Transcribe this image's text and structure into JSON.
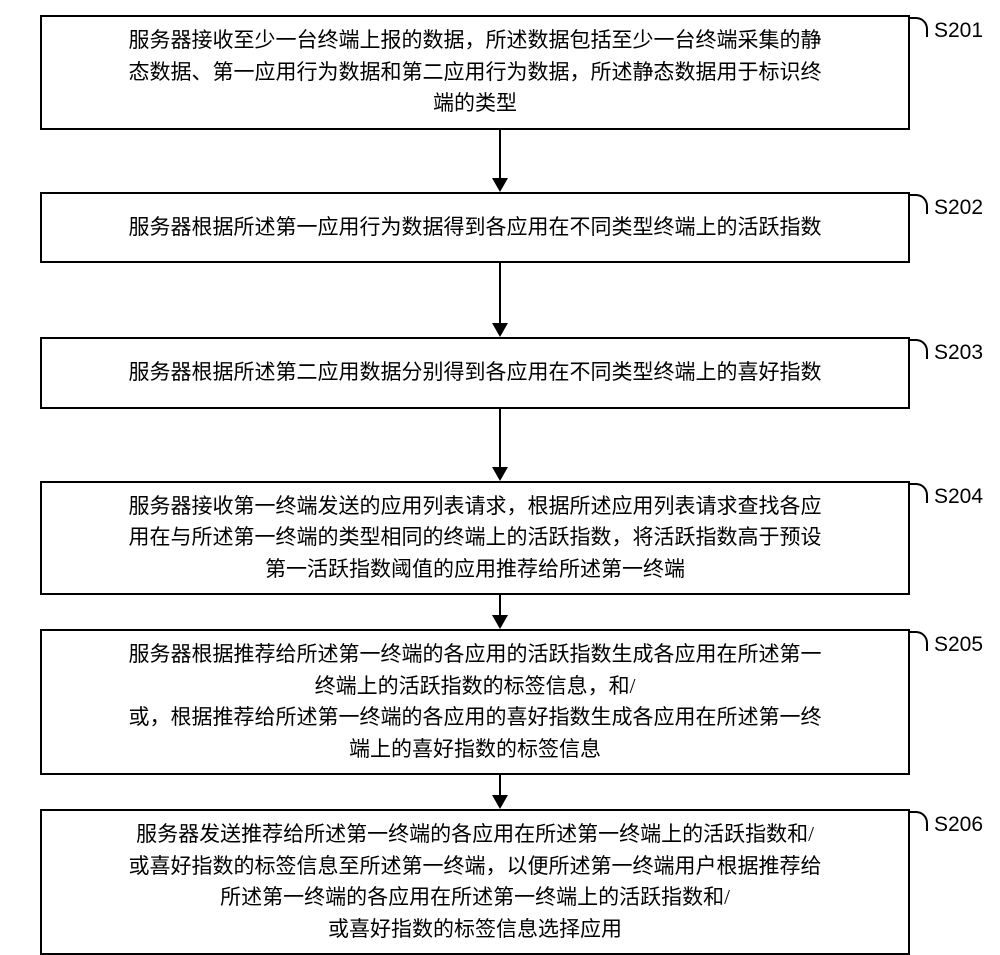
{
  "flowchart": {
    "steps": [
      {
        "id": "S201",
        "lines": [
          "服务器接收至少一台终端上报的数据，所述数据包括至少一台终端采集的静",
          "态数据、第一应用行为数据和第二应用行为数据，所述静态数据用于标识终",
          "端的类型"
        ],
        "arrowHeight": 48
      },
      {
        "id": "S202",
        "lines": [
          "服务器根据所述第一应用行为数据得到各应用在不同类型终端上的活跃指数"
        ],
        "arrowHeight": 60
      },
      {
        "id": "S203",
        "lines": [
          "服务器根据所述第二应用数据分别得到各应用在不同类型终端上的喜好指数"
        ],
        "arrowHeight": 58
      },
      {
        "id": "S204",
        "lines": [
          "服务器接收第一终端发送的应用列表请求，根据所述应用列表请求查找各应",
          "用在与所述第一终端的类型相同的终端上的活跃指数，将活跃指数高于预设",
          "第一活跃指数阈值的应用推荐给所述第一终端"
        ],
        "arrowHeight": 20
      },
      {
        "id": "S205",
        "lines": [
          "服务器根据推荐给所述第一终端的各应用的活跃指数生成各应用在所述第一",
          "终端上的活跃指数的标签信息，和/",
          "或，根据推荐给所述第一终端的各应用的喜好指数生成各应用在所述第一终",
          "端上的喜好指数的标签信息"
        ],
        "arrowHeight": 20
      },
      {
        "id": "S206",
        "lines": [
          "服务器发送推荐给所述第一终端的各应用在所述第一终端上的活跃指数和/",
          "或喜好指数的标签信息至所述第一终端，以便所述第一终端用户根据推荐给",
          "所述第一终端的各应用在所述第一终端上的活跃指数和/",
          "或喜好指数的标签信息选择应用"
        ],
        "arrowHeight": 0
      }
    ]
  }
}
